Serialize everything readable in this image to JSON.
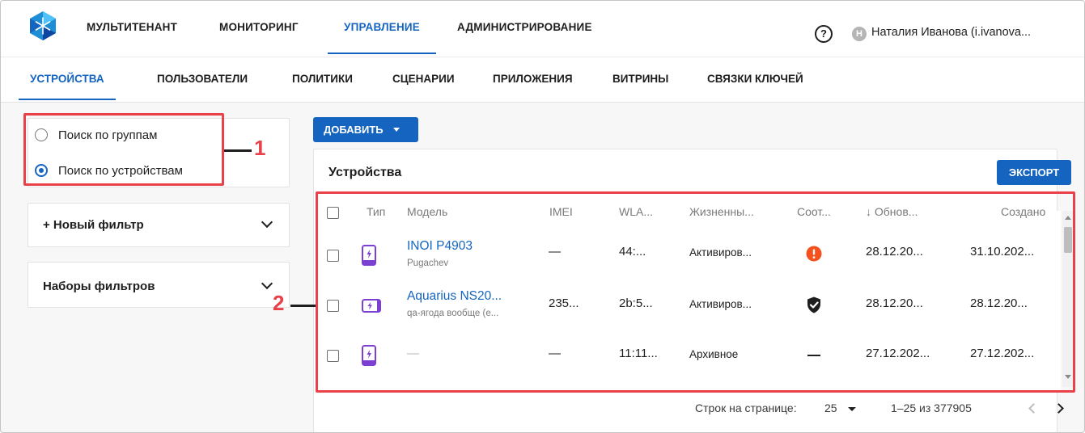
{
  "topnav": {
    "items": [
      "МУЛЬТИТЕНАНТ",
      "МОНИТОРИНГ",
      "УПРАВЛЕНИЕ",
      "АДМИНИСТРИРОВАНИЕ"
    ],
    "active_index": 2,
    "help_label": "?",
    "avatar_initial": "Н",
    "user_name": "Наталия Иванова (i.ivanova..."
  },
  "subnav": {
    "tabs": [
      "УСТРОЙСТВА",
      "ПОЛЬЗОВАТЕЛИ",
      "ПОЛИТИКИ",
      "СЦЕНАРИИ",
      "ПРИЛОЖЕНИЯ",
      "ВИТРИНЫ",
      "СВЯЗКИ КЛЮЧЕЙ"
    ],
    "active_index": 0
  },
  "left": {
    "search_mode": {
      "options": [
        "Поиск по группам",
        "Поиск по устройствам"
      ],
      "selected_index": 1
    },
    "new_filter_label": "+ Новый фильтр",
    "filter_sets_label": "Наборы фильтров"
  },
  "annotations": {
    "callout_1": "1",
    "callout_2": "2"
  },
  "main": {
    "add_button": "ДОБАВИТЬ",
    "title": "Устройства",
    "export_button": "ЭКСПОРТ",
    "columns": [
      "Тип",
      "Модель",
      "IMEI",
      "WLA...",
      "Жизненны...",
      "Соот...",
      "↓ Обнов...",
      "Создано"
    ],
    "rows": [
      {
        "type_icon": "phone-icon",
        "model": "INOI P4903",
        "model_sub": "Pugachev",
        "imei": "—",
        "wlan": "44:...",
        "lifecycle": "Активиров...",
        "compliance_icon": "alert-icon",
        "updated": "28.12.20...",
        "created": "31.10.202..."
      },
      {
        "type_icon": "tablet-icon",
        "model": "Aquarius NS20...",
        "model_sub": "qa-ягода вообще (е...",
        "imei": "235...",
        "wlan": "2b:5...",
        "lifecycle": "Активиров...",
        "compliance_icon": "shield-check-icon",
        "updated": "28.12.20...",
        "created": "28.12.20..."
      },
      {
        "type_icon": "phone-icon",
        "model": "—",
        "model_sub": "",
        "imei": "—",
        "wlan": "11:11...",
        "lifecycle": "Архивное",
        "compliance_icon": "dash-icon",
        "updated": "27.12.202...",
        "created": "27.12.202..."
      }
    ],
    "pagination": {
      "rows_per_page_label": "Строк на странице:",
      "rows_per_page": "25",
      "range": "1–25 из 377905"
    }
  },
  "colors": {
    "primary": "#1565c0",
    "annotation_red": "#e8414a",
    "device_icon": "#7b3fd1",
    "alert": "#f4511e"
  }
}
